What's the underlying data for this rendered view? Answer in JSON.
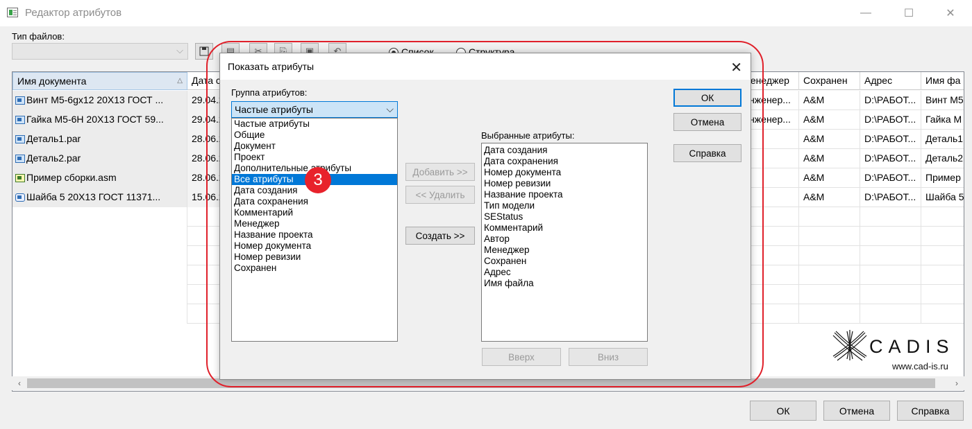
{
  "window": {
    "title": "Редактор атрибутов",
    "controls": [
      "—",
      "☐",
      "✕"
    ]
  },
  "toolbar": {
    "file_type_label": "Тип файлов:",
    "file_type_value": "",
    "view_list_label": "Список",
    "view_structure_label": "Структура"
  },
  "grid": {
    "columns": [
      "Имя документа",
      "Дата с",
      "Менеджер",
      "Сохранен",
      "Адрес",
      "Имя фа"
    ],
    "rows": [
      {
        "name": "Винт М5-6gx12 20Х13 ГОСТ ...",
        "date": "29.04.2",
        "manager": "Инженер...",
        "saved": "A&M",
        "address": "D:\\РАБОТ...",
        "filename": "Винт М5"
      },
      {
        "name": "Гайка М5-6Н 20Х13 ГОСТ 59...",
        "date": "29.04.2",
        "manager": "Инженер...",
        "saved": "A&M",
        "address": "D:\\РАБОТ...",
        "filename": "Гайка М"
      },
      {
        "name": "Деталь1.par",
        "date": "28.06.2",
        "manager": "",
        "saved": "A&M",
        "address": "D:\\РАБОТ...",
        "filename": "Деталь1"
      },
      {
        "name": "Деталь2.par",
        "date": "28.06.2",
        "manager": "",
        "saved": "A&M",
        "address": "D:\\РАБОТ...",
        "filename": "Деталь2"
      },
      {
        "name": "Пример сборки.asm",
        "date": "28.06.2",
        "manager": "",
        "saved": "A&M",
        "address": "D:\\РАБОТ...",
        "filename": "Пример"
      },
      {
        "name": "Шайба 5 20Х13 ГОСТ 11371...",
        "date": "15.06.2",
        "manager": "",
        "saved": "A&M",
        "address": "D:\\РАБОТ...",
        "filename": "Шайба 5"
      }
    ]
  },
  "buttons": {
    "ok": "ОК",
    "cancel": "Отмена",
    "help": "Справка"
  },
  "logo": {
    "text": "CADIS",
    "url": "www.cad-is.ru"
  },
  "dialog": {
    "title": "Показать атрибуты",
    "group_label": "Группа атрибутов:",
    "group_selected": "Частые атрибуты",
    "available": [
      "Частые атрибуты",
      "Общие",
      "Документ",
      "Проект",
      "Дополнительные атрибуты",
      "Все атрибуты",
      "Дата создания",
      "Дата сохранения",
      "Комментарий",
      "Менеджер",
      "Название проекта",
      "Номер документа",
      "Номер ревизии",
      "Сохранен"
    ],
    "highlighted_option": "Все атрибуты",
    "selected_label": "Выбранные атрибуты:",
    "selected": [
      "Дата создания",
      "Дата сохранения",
      "Номер документа",
      "Номер ревизии",
      "Название проекта",
      "Тип модели",
      "SEStatus",
      "Комментарий",
      "Автор",
      "Менеджер",
      "Сохранен",
      "Адрес",
      "Имя файла"
    ],
    "add_button": "Добавить >>",
    "remove_button": "<< Удалить",
    "create_button": "Создать >>",
    "ok_button": "ОК",
    "cancel_button": "Отмена",
    "help_button": "Справка",
    "up_button": "Вверх",
    "down_button": "Вниз"
  },
  "annotation": {
    "step": "3",
    "outline_color": "#e0202a",
    "badge_color": "#e8222b"
  },
  "colors": {
    "accent": "#0078d7",
    "selection_bg": "#0078d7",
    "combo_bg": "#cce4f7"
  }
}
